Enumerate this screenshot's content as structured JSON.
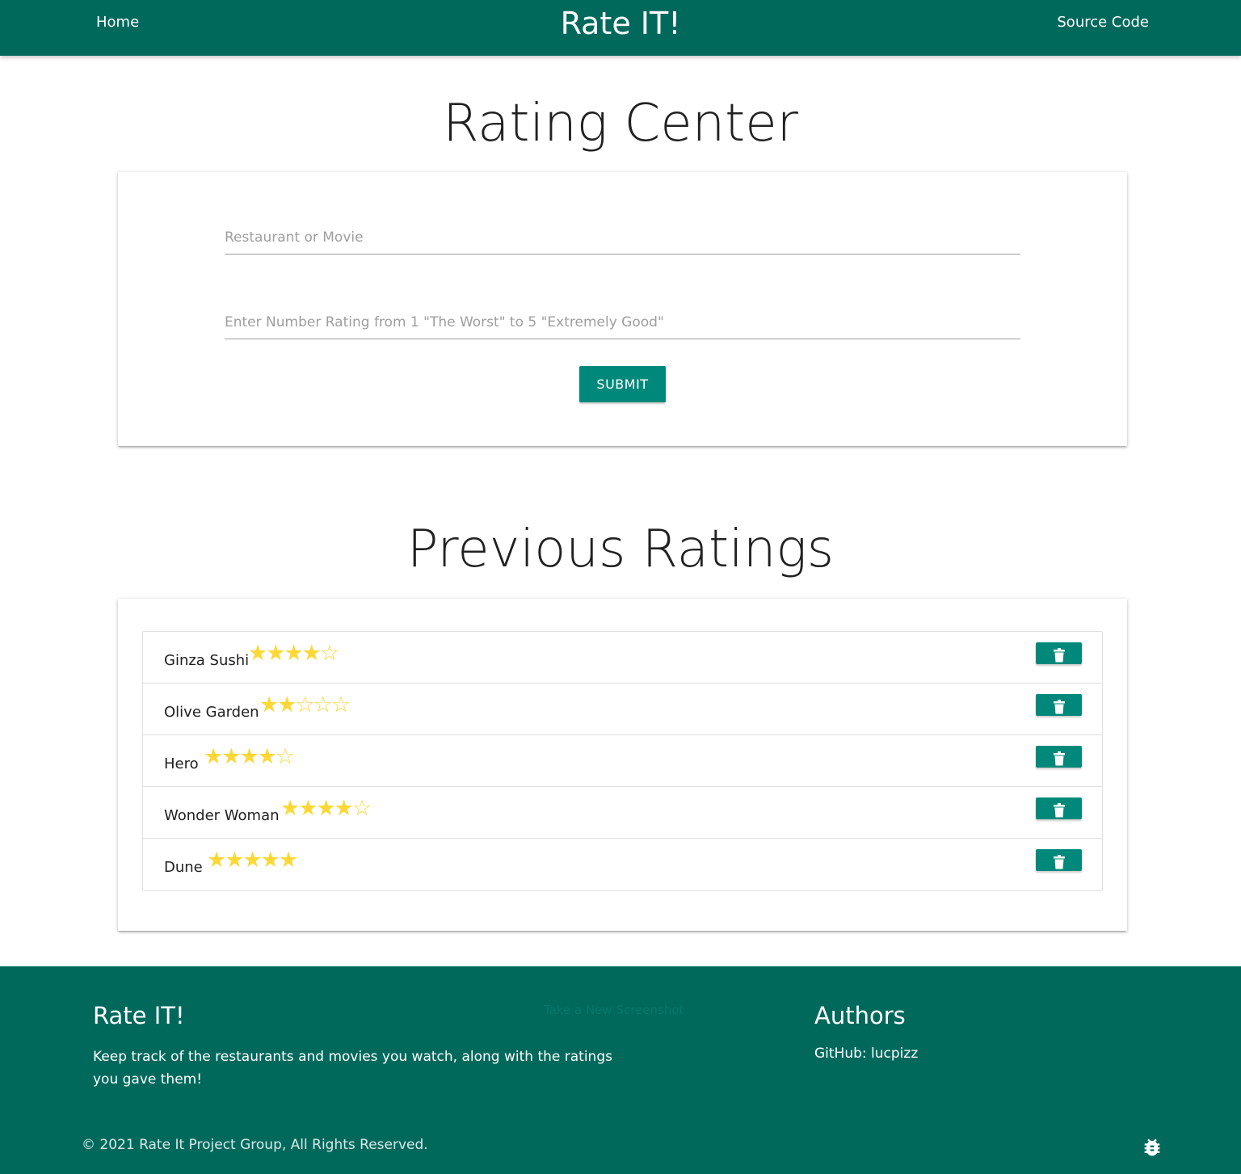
{
  "nav": {
    "home_label": "Home",
    "brand": "Rate IT!",
    "source_label": "Source Code"
  },
  "rating_center": {
    "title": "Rating Center",
    "name_placeholder": "Restaurant or Movie",
    "rating_placeholder": "Enter Number Rating from 1 \"The Worst\" to 5 \"Extremely Good\"",
    "submit_label": "SUBMIT"
  },
  "previous": {
    "title": "Previous Ratings",
    "items": [
      {
        "name": "Ginza Sushi",
        "rating": 4
      },
      {
        "name": "Olive Garden",
        "rating": 2
      },
      {
        "name": "Hero",
        "rating": 4
      },
      {
        "name": "Wonder Woman",
        "rating": 4
      },
      {
        "name": "Dune",
        "rating": 5
      }
    ],
    "max_rating": 5
  },
  "footer": {
    "brand": "Rate IT!",
    "description": "Keep track of the restaurants and movies you watch, along with the ratings you gave them!",
    "ghost_text": "Take a New Screenshot",
    "authors_heading": "Authors",
    "github_label": "GitHub: lucpizz",
    "copyright": "© 2021 Rate It Project Group, All Rights Reserved."
  },
  "icons": {
    "delete": "trash-icon",
    "footer": "bug-icon"
  },
  "colors": {
    "primary_dark": "#00695c",
    "primary": "#00897b",
    "star": "#fdd835"
  }
}
